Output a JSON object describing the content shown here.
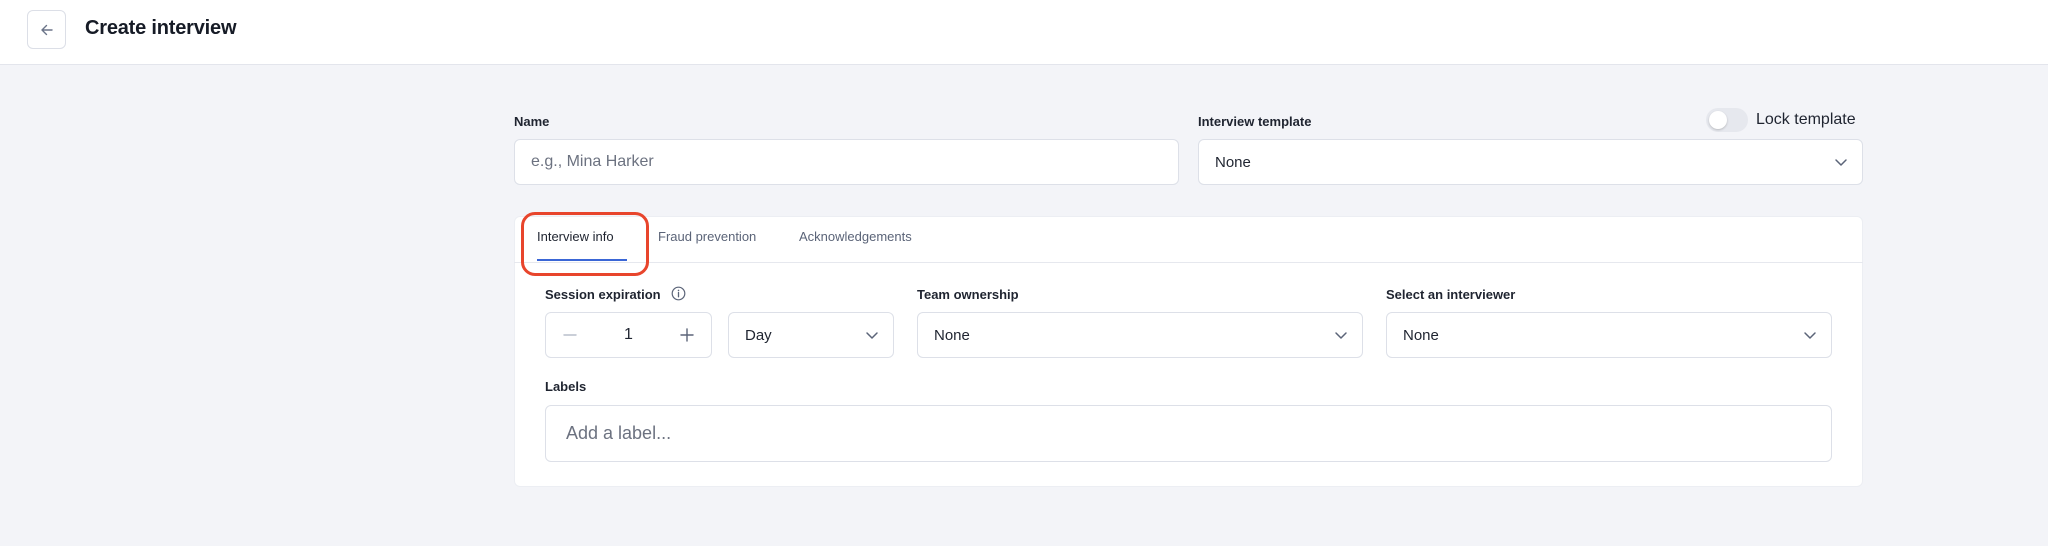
{
  "header": {
    "title": "Create interview",
    "back_icon": "arrow-left-icon"
  },
  "form": {
    "name": {
      "label": "Name",
      "placeholder": "e.g., Mina Harker",
      "value": ""
    },
    "interview_template": {
      "label": "Interview template",
      "value": "None"
    },
    "lock_template": {
      "label": "Lock template",
      "enabled": false
    }
  },
  "tabs": [
    {
      "label": "Interview info",
      "active": true
    },
    {
      "label": "Fraud prevention",
      "active": false
    },
    {
      "label": "Acknowledgements",
      "active": false
    }
  ],
  "interview_info": {
    "session_expiration": {
      "label": "Session expiration",
      "value": "1",
      "unit": "Day"
    },
    "team_ownership": {
      "label": "Team ownership",
      "value": "None"
    },
    "interviewer": {
      "label": "Select an interviewer",
      "value": "None"
    },
    "labels": {
      "label": "Labels",
      "placeholder": "Add a label..."
    }
  },
  "colors": {
    "accent": "#3a66d6",
    "highlight": "#e8452c",
    "background": "#f3f4f8"
  }
}
